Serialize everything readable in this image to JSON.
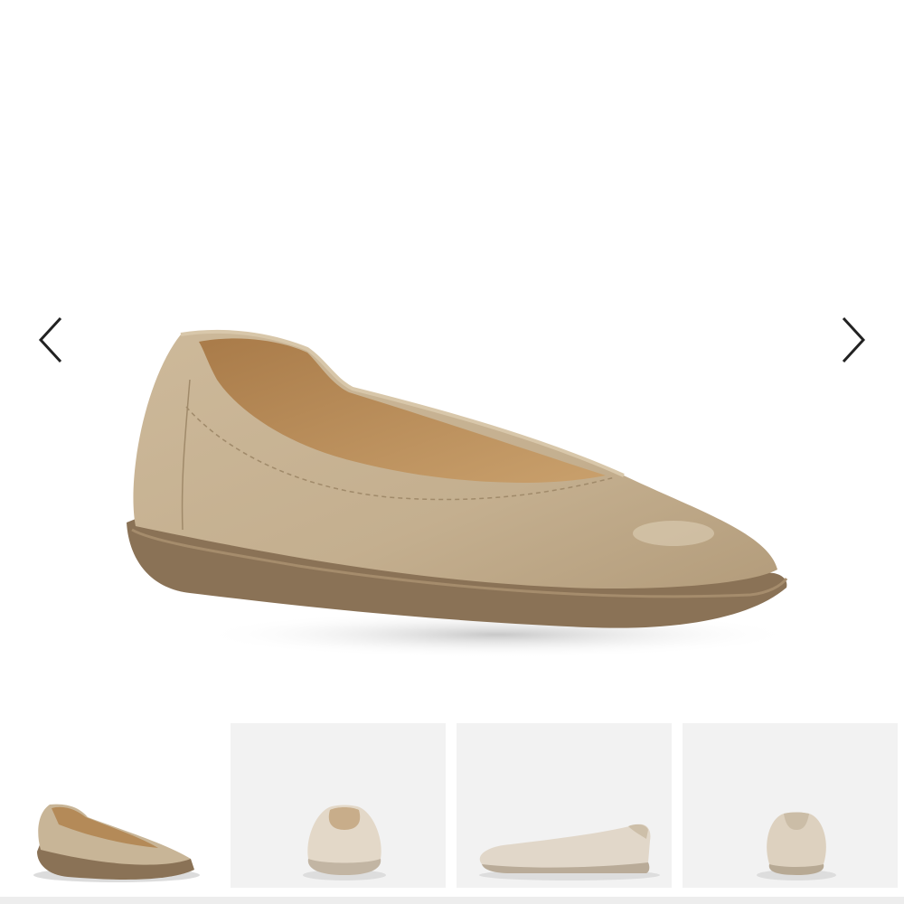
{
  "gallery": {
    "main_image": {
      "alt": "",
      "view": "three-quarter-front"
    },
    "prev_icon": "chevron-left-icon",
    "next_icon": "chevron-right-icon",
    "thumbnails": [
      {
        "view": "three-quarter-front",
        "selected": true
      },
      {
        "view": "front",
        "selected": false
      },
      {
        "view": "side",
        "selected": false
      },
      {
        "view": "back",
        "selected": false
      }
    ]
  },
  "colors": {
    "leather": "#c7b394",
    "sole": "#8a7256",
    "lining": "#b88e5c",
    "thumb_bg": "#f2f2f2",
    "arrow": "#222222"
  }
}
